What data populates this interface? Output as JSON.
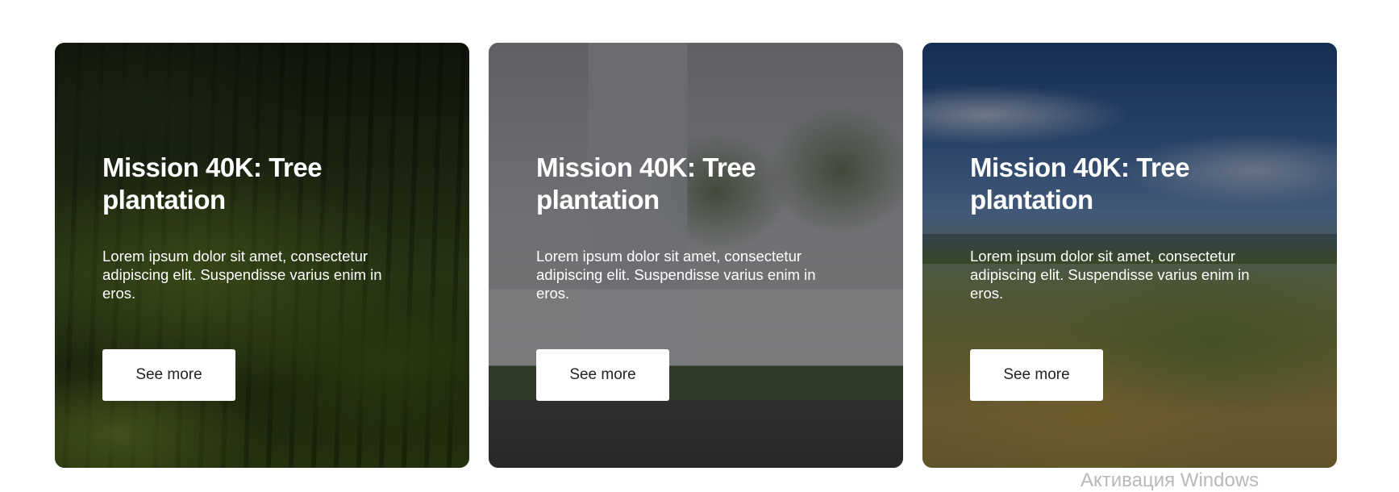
{
  "cards": [
    {
      "title": "Mission 40K: Tree plantation",
      "description": "Lorem ipsum dolor sit amet, consectetur adipiscing elit. Suspendisse varius enim in eros.",
      "button_label": "See more",
      "image": "forest-photo"
    },
    {
      "title": "Mission 40K: Tree plantation",
      "description": "Lorem ipsum dolor sit amet, consectetur adipiscing elit. Suspendisse varius enim in eros.",
      "button_label": "See more",
      "image": "city-street-palms-photo"
    },
    {
      "title": "Mission 40K: Tree plantation",
      "description": "Lorem ipsum dolor sit amet, consectetur adipiscing elit. Suspendisse varius enim in eros.",
      "button_label": "See more",
      "image": "hillside-landscape-photo"
    }
  ],
  "watermark": "Активация Windows"
}
